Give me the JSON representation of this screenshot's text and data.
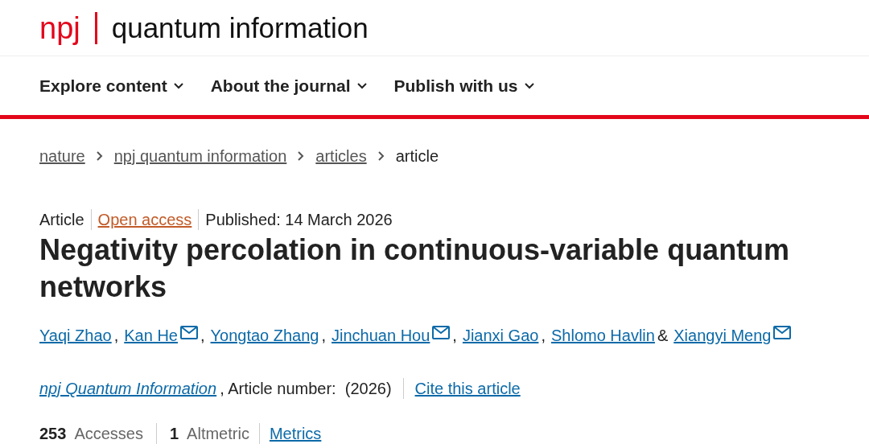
{
  "logo": {
    "brand": "npj",
    "journal": "quantum information"
  },
  "nav": [
    {
      "label": "Explore content"
    },
    {
      "label": "About the journal"
    },
    {
      "label": "Publish with us"
    }
  ],
  "breadcrumb": [
    {
      "label": "nature",
      "link": true
    },
    {
      "label": "npj quantum information",
      "link": true
    },
    {
      "label": "articles",
      "link": true
    },
    {
      "label": "article",
      "link": false
    }
  ],
  "meta": {
    "type": "Article",
    "access": "Open access",
    "published": "Published: 14 March 2026"
  },
  "title": "Negativity percolation in continuous-variable quantum networks",
  "authors": [
    {
      "name": "Yaqi Zhao",
      "email": false,
      "separator": ","
    },
    {
      "name": "Kan He",
      "email": true,
      "separator": ","
    },
    {
      "name": "Yongtao Zhang",
      "email": false,
      "separator": ","
    },
    {
      "name": "Jinchuan Hou",
      "email": true,
      "separator": ","
    },
    {
      "name": "Jianxi Gao",
      "email": false,
      "separator": ","
    },
    {
      "name": "Shlomo Havlin",
      "email": false,
      "separator": "&"
    },
    {
      "name": "Xiangyi Meng",
      "email": true
    }
  ],
  "citation": {
    "journal": "npj Quantum Information",
    "details": ", Article number:  (2026)",
    "cite": "Cite this article"
  },
  "accesses": {
    "count": "253",
    "label": "Accesses"
  },
  "altmetric": {
    "count": "1",
    "label": "Altmetric"
  },
  "metrics_link": "Metrics"
}
